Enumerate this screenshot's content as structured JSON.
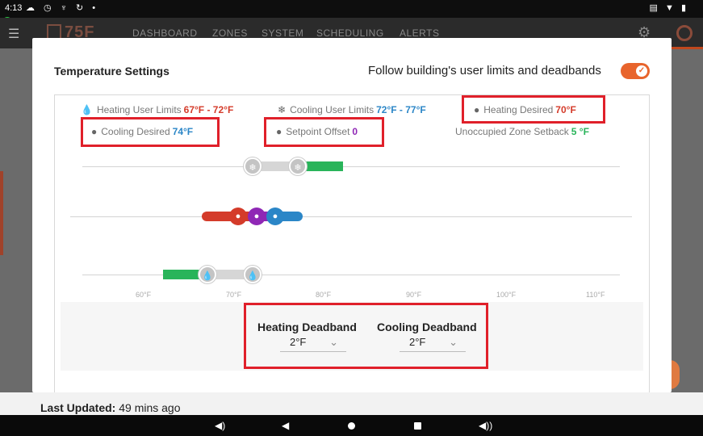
{
  "status_bar": {
    "time": "4:13",
    "left_icons": "☁ ◷ ♆ ↻ •",
    "right_icons": "▤ ▼ ▮"
  },
  "nav": {
    "logo": "75F",
    "items": [
      "DASHBOARD",
      "ZONES",
      "SYSTEM",
      "SCHEDULING",
      "ALERTS"
    ],
    "settings_icon": "⚙"
  },
  "background": {
    "last_updated_label": "Last Updated:",
    "last_updated_value": "49 mins ago"
  },
  "modal": {
    "title": "Temperature Settings",
    "follow_label": "Follow building's user limits and deadbands",
    "follow_enabled": true,
    "limits": {
      "heating_user_limits_label": "Heating User Limits",
      "heating_user_limits_value": "67°F - 72°F",
      "cooling_user_limits_label": "Cooling User Limits",
      "cooling_user_limits_value": "72°F - 77°F",
      "heating_desired_label": "Heating Desired",
      "heating_desired_value": "70°F",
      "cooling_desired_label": "Cooling Desired",
      "cooling_desired_value": "74°F",
      "setpoint_offset_label": "Setpoint Offset",
      "setpoint_offset_value": "0",
      "unoccupied_setback_label": "Unoccupied Zone Setback",
      "unoccupied_setback_value": "5 °F"
    },
    "scale_ticks": [
      "60°F",
      "70°F",
      "80°F",
      "90°F",
      "100°F",
      "110°F"
    ],
    "deadband": {
      "heating_label": "Heating Deadband",
      "heating_value": "2°F",
      "cooling_label": "Cooling Deadband",
      "cooling_value": "2°F"
    }
  },
  "colors": {
    "heating": "#d43b2a",
    "cooling": "#2b86c7",
    "offset": "#8f27b5",
    "setback": "#29b45a",
    "accent": "#e8642c",
    "highlight": "#e0202a"
  }
}
